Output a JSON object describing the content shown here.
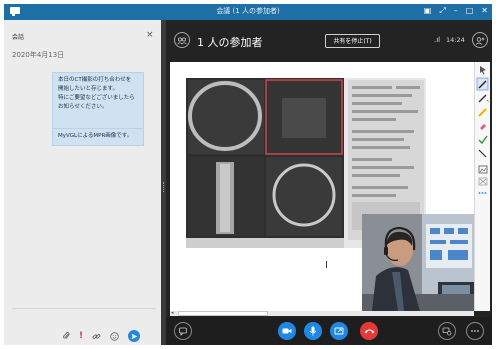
{
  "window": {
    "title": "会議 (1 人の参加者)"
  },
  "chat": {
    "header": "会話",
    "close": "×",
    "date": "2020年4月13日",
    "messages": [
      {
        "lines": [
          "本日のCT撮影の打ち合わせを",
          "開始したいと存じます。",
          "特にご要望などございましたら",
          "お知らせください。"
        ]
      },
      {
        "lines": [
          "MyVGLによるMPR画像です。"
        ]
      }
    ]
  },
  "meeting": {
    "participants": "1 人の参加者",
    "stop_sharing": "共有を停止(T)",
    "time": "14:24"
  },
  "colors": {
    "titlebar": "#1e6fa6",
    "bubble": "#cfe2f1",
    "accent_blue": "#1e88e5",
    "hangup_red": "#e53935",
    "annotation_red": "#d0454b"
  },
  "icons": {
    "chat_tools": [
      "paperclip-icon",
      "priority-icon",
      "link-icon",
      "emoji-icon",
      "send-icon"
    ],
    "bottom": [
      "chat-icon",
      "camera-icon",
      "mic-icon",
      "share-icon",
      "hangup-icon",
      "device-settings-icon",
      "more-icon"
    ],
    "annotation_tools": [
      "cursor-icon",
      "pen-icon",
      "highlighter-icon",
      "laser-icon",
      "checkmark-icon",
      "line-icon",
      "image-icon",
      "eraser-icon",
      "more-icon"
    ]
  }
}
